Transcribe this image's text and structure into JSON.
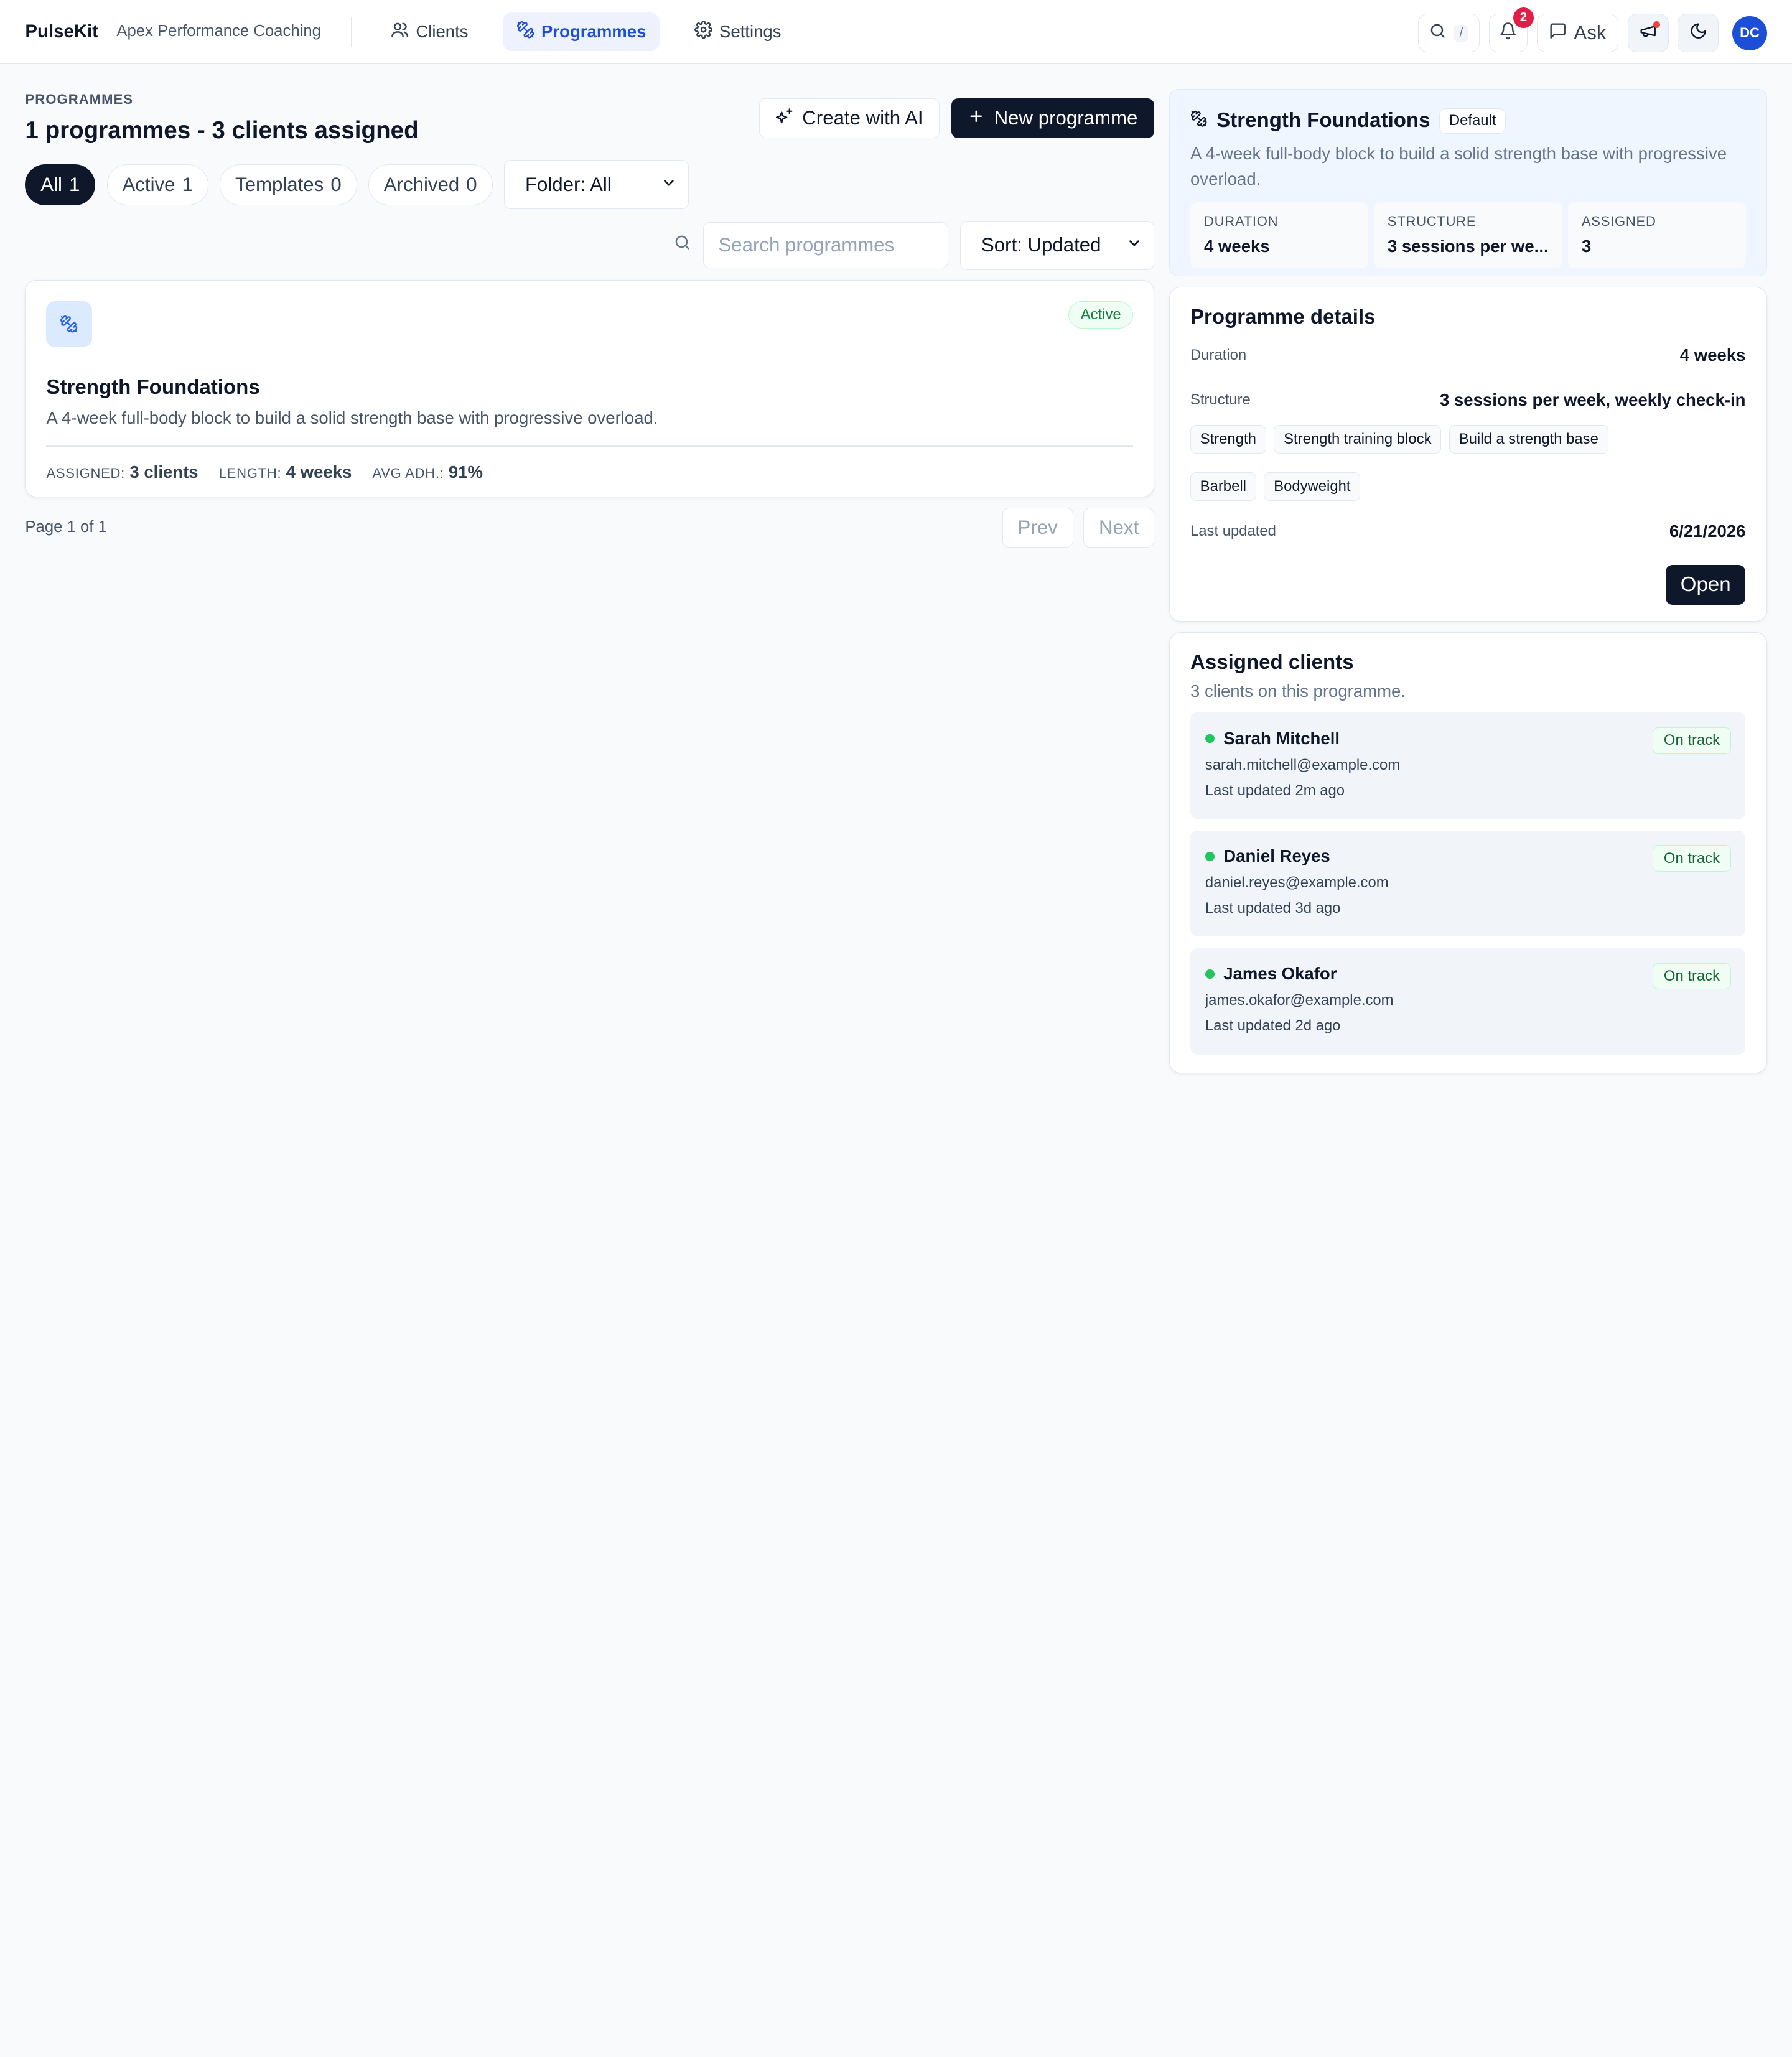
{
  "app": {
    "brand": "PulseKit",
    "org": "Apex Performance Coaching",
    "nav": [
      {
        "label": "Clients",
        "icon": "users-icon"
      },
      {
        "label": "Programmes",
        "icon": "dumbbell-icon"
      },
      {
        "label": "Settings",
        "icon": "gear-icon"
      }
    ],
    "search_shortcut": "/",
    "notifications_count": "2",
    "ask_label": "Ask",
    "avatar_initials": "DC"
  },
  "header": {
    "eyebrow": "PROGRAMMES",
    "title": "1 programmes - 3 clients assigned",
    "create_ai_label": "Create with AI",
    "new_programme_label": "New programme"
  },
  "filters": {
    "tabs": [
      {
        "label": "All",
        "count": "1"
      },
      {
        "label": "Active",
        "count": "1"
      },
      {
        "label": "Templates",
        "count": "0"
      },
      {
        "label": "Archived",
        "count": "0"
      }
    ],
    "folder": "Folder: All",
    "search_placeholder": "Search programmes",
    "sort": "Sort: Updated"
  },
  "programme_card": {
    "status": "Active",
    "title": "Strength Foundations",
    "description": "A 4-week full-body block to build a solid strength base with progressive overload.",
    "assigned_label": "ASSIGNED:",
    "assigned_value": "3 clients",
    "length_label": "LENGTH:",
    "length_value": "4 weeks",
    "adherence_label": "AVG ADH.:",
    "adherence_value": "91%"
  },
  "pager": {
    "text": "Page 1 of 1",
    "prev": "Prev",
    "next": "Next"
  },
  "summary": {
    "title": "Strength Foundations",
    "badge": "Default",
    "description": "A 4-week full-body block to build a solid strength base with progressive overload.",
    "stats": [
      {
        "label": "DURATION",
        "value": "4 weeks"
      },
      {
        "label": "STRUCTURE",
        "value": "3 sessions per we..."
      },
      {
        "label": "ASSIGNED",
        "value": "3"
      }
    ]
  },
  "details": {
    "heading": "Programme details",
    "duration_label": "Duration",
    "duration_value": "4 weeks",
    "structure_label": "Structure",
    "structure_value": "3 sessions per week, weekly check-in",
    "tags": [
      "Strength",
      "Strength training block",
      "Build a strength base",
      "Barbell",
      "Bodyweight"
    ],
    "updated_label": "Last updated",
    "updated_value": "6/21/2026",
    "open_label": "Open"
  },
  "assigned_clients": {
    "heading": "Assigned clients",
    "subtitle": "3 clients on this programme.",
    "clients": [
      {
        "name": "Sarah Mitchell",
        "email": "sarah.mitchell@example.com",
        "updated": "Last updated 2m ago",
        "status": "On track"
      },
      {
        "name": "Daniel Reyes",
        "email": "daniel.reyes@example.com",
        "updated": "Last updated 3d ago",
        "status": "On track"
      },
      {
        "name": "James Okafor",
        "email": "james.okafor@example.com",
        "updated": "Last updated 2d ago",
        "status": "On track"
      }
    ]
  },
  "colors": {
    "primary_dark": "#0f172a",
    "accent_blue": "#1d4ed8",
    "success_green": "#22c55e",
    "alert_red": "#e11d48"
  }
}
